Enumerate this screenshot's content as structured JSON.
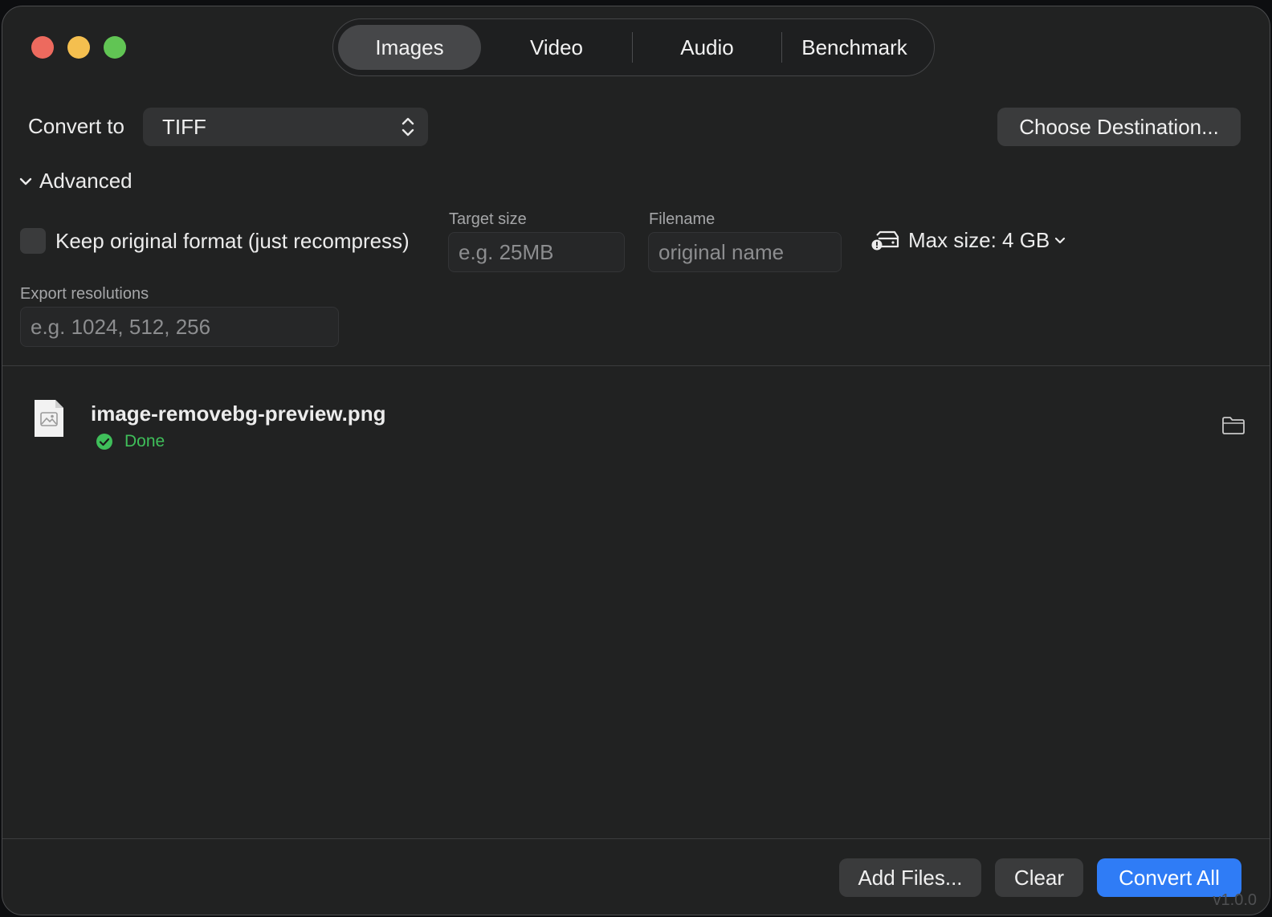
{
  "tabs": [
    {
      "label": "Images",
      "active": true
    },
    {
      "label": "Video",
      "active": false
    },
    {
      "label": "Audio",
      "active": false
    },
    {
      "label": "Benchmark",
      "active": false
    }
  ],
  "convert": {
    "label": "Convert to",
    "selected_format": "TIFF",
    "choose_destination": "Choose Destination..."
  },
  "advanced": {
    "label": "Advanced",
    "expanded": true,
    "keep_original_label": "Keep original format (just recompress)",
    "keep_original_checked": false,
    "target_size_label": "Target size",
    "target_size_placeholder": "e.g. 25MB",
    "target_size_value": "",
    "filename_label": "Filename",
    "filename_placeholder": "original name",
    "filename_value": "",
    "max_size_label": "Max size: 4 GB",
    "export_resolutions_label": "Export resolutions",
    "export_resolutions_placeholder": "e.g. 1024, 512, 256",
    "export_resolutions_value": ""
  },
  "files": [
    {
      "name": "image-removebg-preview.png",
      "status": "Done"
    }
  ],
  "footer": {
    "add_files": "Add Files...",
    "clear": "Clear",
    "convert_all": "Convert All",
    "version": "v1.0.0"
  },
  "colors": {
    "window_bg": "#212222",
    "accent": "#2f7cf6",
    "success": "#3fbf5a",
    "close": "#ed6a5e",
    "minimize": "#f4bf4f",
    "maximize": "#61c554"
  }
}
